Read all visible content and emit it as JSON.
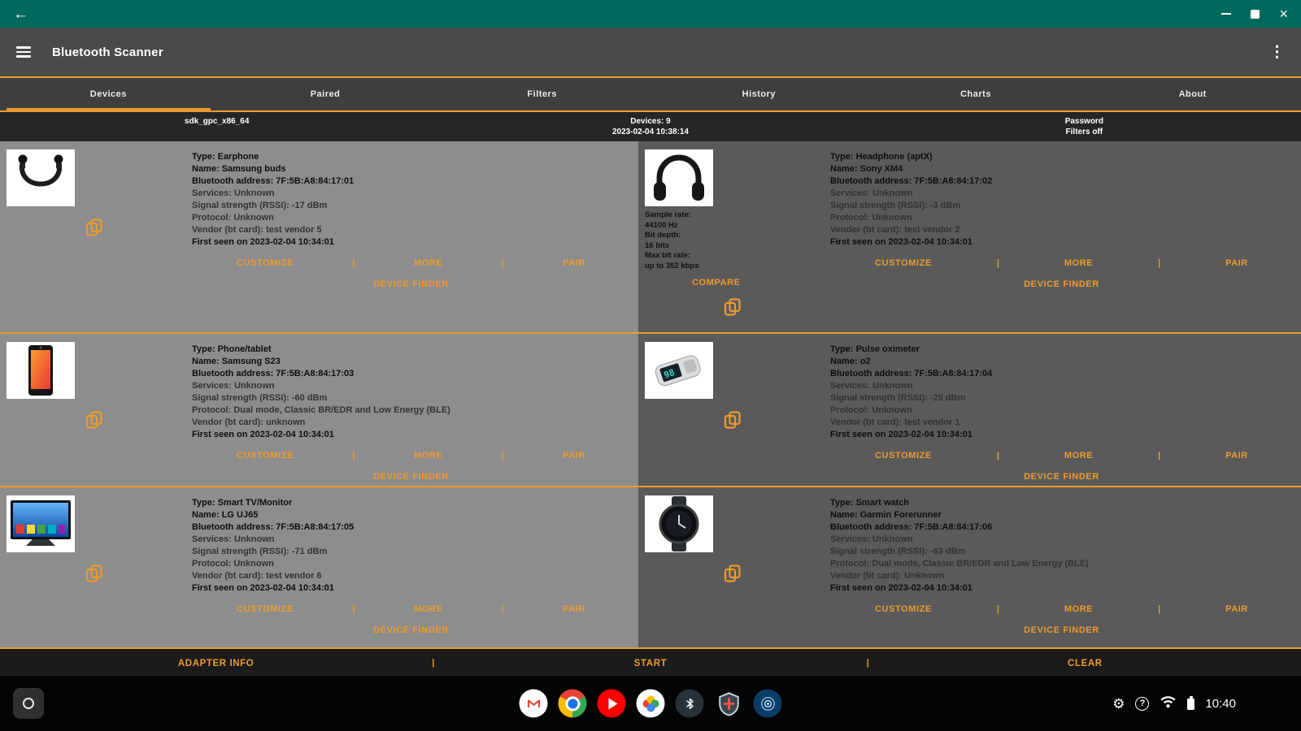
{
  "colors": {
    "accent": "#EC9B2D",
    "teal": "#00695C"
  },
  "toolbar": {
    "title": "Bluetooth Scanner"
  },
  "tabs": [
    "Devices",
    "Paired",
    "Filters",
    "History",
    "Charts",
    "About"
  ],
  "active_tab": "Devices",
  "statusbar": {
    "build": "sdk_gpc_x86_64",
    "devices_count": "Devices: 9",
    "scan_time": "2023-02-04 10:38:14",
    "password": "Password",
    "filters": "Filters off"
  },
  "field_labels": {
    "type": "Type:",
    "name": "Name:",
    "address": "Bluetooth address:",
    "services": "Services:",
    "rssi": "Signal strength (RSSI):",
    "protocol": "Protocol:",
    "vendor": "Vendor (bt card):",
    "first_seen": "First seen on"
  },
  "actions": {
    "customize": "CUSTOMIZE",
    "more": "MORE",
    "pair": "PAIR",
    "device_finder": "DEVICE FINDER",
    "compare": "COMPARE",
    "separator": "|"
  },
  "devices": [
    {
      "type": "Earphone",
      "name": "Samsung buds",
      "address": "7F:5B:A8:84:17:01",
      "services": "Unknown",
      "rssi": "-17 dBm",
      "protocol": "Unknown",
      "vendor": "test vendor 5",
      "first_seen": "2023-02-04 10:34:01"
    },
    {
      "type": "Headphone (aptX)",
      "name": "Sony XM4",
      "address": "7F:5B:A8:84:17:02",
      "services": "Unknown",
      "rssi": "-3 dBm",
      "protocol": "Unknown",
      "vendor": "test vendor 2",
      "first_seen": "2023-02-04 10:34:01",
      "codec": {
        "sample_rate_label": "Sample rate:",
        "sample_rate": "44100 Hz",
        "bit_depth_label": "Bit depth:",
        "bit_depth": "16 bits",
        "max_bitrate_label": "Max bit rate:",
        "max_bitrate": "up to 352 kbps"
      }
    },
    {
      "type": "Phone/tablet",
      "name": "Samsung S23",
      "address": "7F:5B:A8:84:17:03",
      "services": "Unknown",
      "rssi": "-60 dBm",
      "protocol": "Dual mode, Classic BR/EDR and Low Energy (BLE)",
      "vendor": "unknown",
      "first_seen": "2023-02-04 10:34:01"
    },
    {
      "type": "Pulse oximeter",
      "name": "o2",
      "address": "7F:5B:A8:84:17:04",
      "services": "Unknown",
      "rssi": "-25 dBm",
      "protocol": "Unknown",
      "vendor": "test vendor 1",
      "first_seen": "2023-02-04 10:34:01"
    },
    {
      "type": "Smart TV/Monitor",
      "name": "LG UJ65",
      "address": "7F:5B:A8:84:17:05",
      "services": "Unknown",
      "rssi": "-71 dBm",
      "protocol": "Unknown",
      "vendor": "test vendor 6",
      "first_seen": "2023-02-04 10:34:01"
    },
    {
      "type": "Smart watch",
      "name": "Garmin Forerunner",
      "address": "7F:5B:A8:84:17:06",
      "services": "Unknown",
      "rssi": "-63 dBm",
      "protocol": "Dual mode, Classic BR/EDR and Low Energy (BLE)",
      "vendor": "Unknown",
      "first_seen": "2023-02-04 10:34:01"
    }
  ],
  "bottombar": {
    "adapter_info": "ADAPTER INFO",
    "start": "START",
    "clear": "CLEAR",
    "separator": "|"
  },
  "shelf": {
    "time": "10:40"
  },
  "icons": {
    "back_glyph": "←",
    "close_glyph": "×",
    "overflow_glyph": "⋮",
    "gear_glyph": "⚙",
    "help_glyph": "?",
    "names": [
      "hamburger-menu",
      "copy",
      "minimize",
      "maximize",
      "close",
      "launcher",
      "gmail",
      "chrome",
      "youtube",
      "google-photos",
      "bluetooth-scanner-app",
      "shield-app",
      "radar-app",
      "settings-gear",
      "help",
      "wifi",
      "battery"
    ]
  }
}
